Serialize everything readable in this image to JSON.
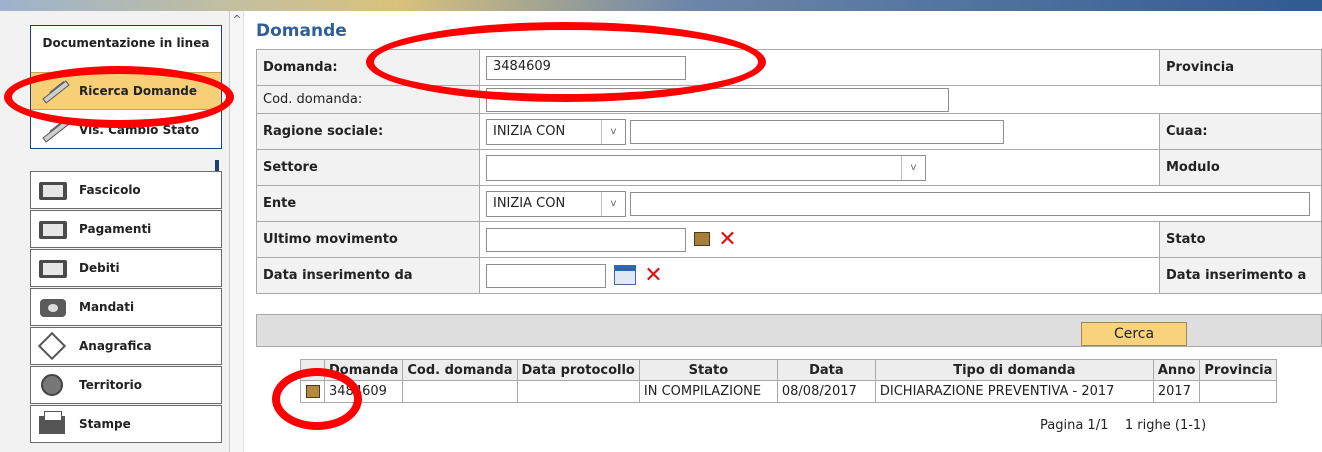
{
  "sidebar": {
    "doc_title": "Documentazione in linea",
    "doc_items": [
      {
        "label": "Ricerca Domande",
        "active": true
      },
      {
        "label": "Vis. Cambio Stato",
        "active": false
      }
    ],
    "nav_items": [
      {
        "label": "Fascicolo",
        "icon": "folder-icon"
      },
      {
        "label": "Pagamenti",
        "icon": "folder-icon"
      },
      {
        "label": "Debiti",
        "icon": "folder-icon"
      },
      {
        "label": "Mandati",
        "icon": "briefcase-icon"
      },
      {
        "label": "Anagrafica",
        "icon": "cube-icon"
      },
      {
        "label": "Territorio",
        "icon": "globe-icon"
      },
      {
        "label": "Stampe",
        "icon": "printer-icon"
      }
    ]
  },
  "page": {
    "title": "Domande"
  },
  "form": {
    "domanda_label": "Domanda:",
    "domanda_value": "3484609",
    "provincia_label": "Provincia",
    "cod_domanda_label": "Cod. domanda:",
    "cod_domanda_value": "",
    "ragione_label": "Ragione sociale:",
    "ragione_select": "INIZIA CON",
    "ragione_value": "",
    "cuaa_label": "Cuaa:",
    "settore_label": "Settore",
    "settore_value": "",
    "modulo_label": "Modulo",
    "ente_label": "Ente",
    "ente_select": "INIZIA CON",
    "ente_value": "",
    "ultimo_label": "Ultimo movimento",
    "ultimo_value": "",
    "stato_label": "Stato",
    "data_da_label": "Data inserimento da",
    "data_da_value": "",
    "data_a_label": "Data inserimento a"
  },
  "search": {
    "button_label": "Cerca"
  },
  "results": {
    "columns": [
      "",
      "Domanda",
      "Cod. domanda",
      "Data protocollo",
      "Stato",
      "Data",
      "Tipo di domanda",
      "Anno",
      "Provincia"
    ],
    "rows": [
      {
        "domanda": "3484609",
        "cod_domanda": "",
        "data_protocollo": "",
        "stato": "IN COMPILAZIONE",
        "data": "08/08/2017",
        "tipo": "DICHIARAZIONE PREVENTIVA - 2017",
        "anno": "2017",
        "provincia": ""
      }
    ],
    "pager_page": "Pagina 1/1",
    "pager_rows": "1 righe (1-1)"
  },
  "colors": {
    "annotation": "#ff0000",
    "active_item": "#f7cf76",
    "title": "#2e5f96"
  }
}
